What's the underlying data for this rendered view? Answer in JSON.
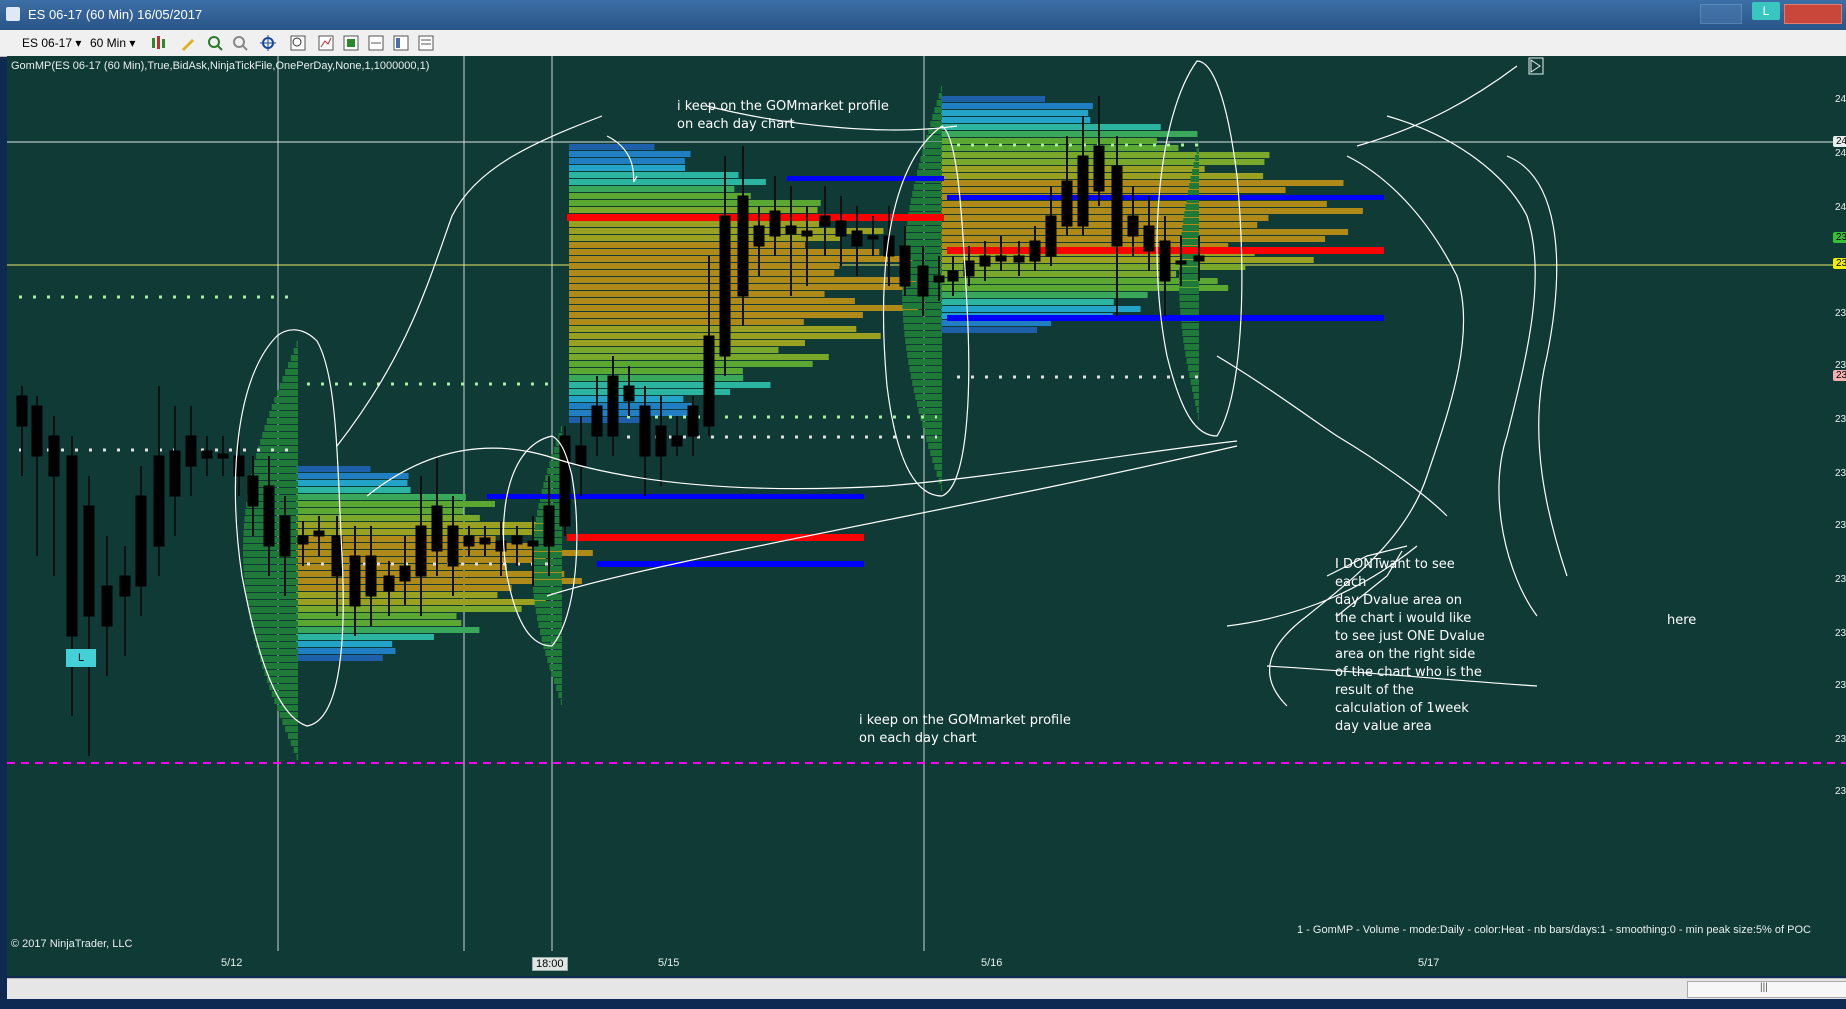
{
  "window": {
    "title": "ES 06-17 (60 Min)  16/05/2017",
    "l_button": "L"
  },
  "toolbar": {
    "instrument": "ES 06-17",
    "interval": "60 Min"
  },
  "chart": {
    "indicator_label": "GomMP(ES 06-17 (60 Min),True,BidAsk,NinjaTickFile,OnePerDay,None,1,1000000,1)",
    "footer_label": "1 - GomMP  - Volume - mode:Daily  - color:Heat - nb bars/days:1 - smoothing:0 - min peak size:5% of POC",
    "copyright": "© 2017 NinjaTrader, LLC",
    "x_labels": [
      "5/12",
      "18:00",
      "5/15",
      "5/16",
      "5/17"
    ],
    "y_labels": [
      "24",
      "24",
      "24",
      "23",
      "23",
      "23",
      "23",
      "23",
      "23",
      "23",
      "23",
      "23",
      "23"
    ],
    "price_tags": [
      "24",
      "23",
      "23",
      "23"
    ],
    "order_tag": "L",
    "colors": {
      "background": "#0f3a36",
      "up_candle": "#ffff00",
      "down_candle": "#000000",
      "poc_line": "#ff0000",
      "value_area_line": "#0000ff",
      "dashed_line": "#ff00ff"
    }
  },
  "annotations": {
    "top_note": "i keep on the GOMmarket profile\non each day chart",
    "mid_note": "i keep on the GOMmarket profile\non each day chart",
    "right_note": "I DONTwant to see\neach\nday Dvalue area on\nthe chart i would like\nto see just ONE Dvalue\narea on the right side\nof the chart who is the\nresult of the\ncalculation of 1week\nday value area",
    "here": "here"
  }
}
